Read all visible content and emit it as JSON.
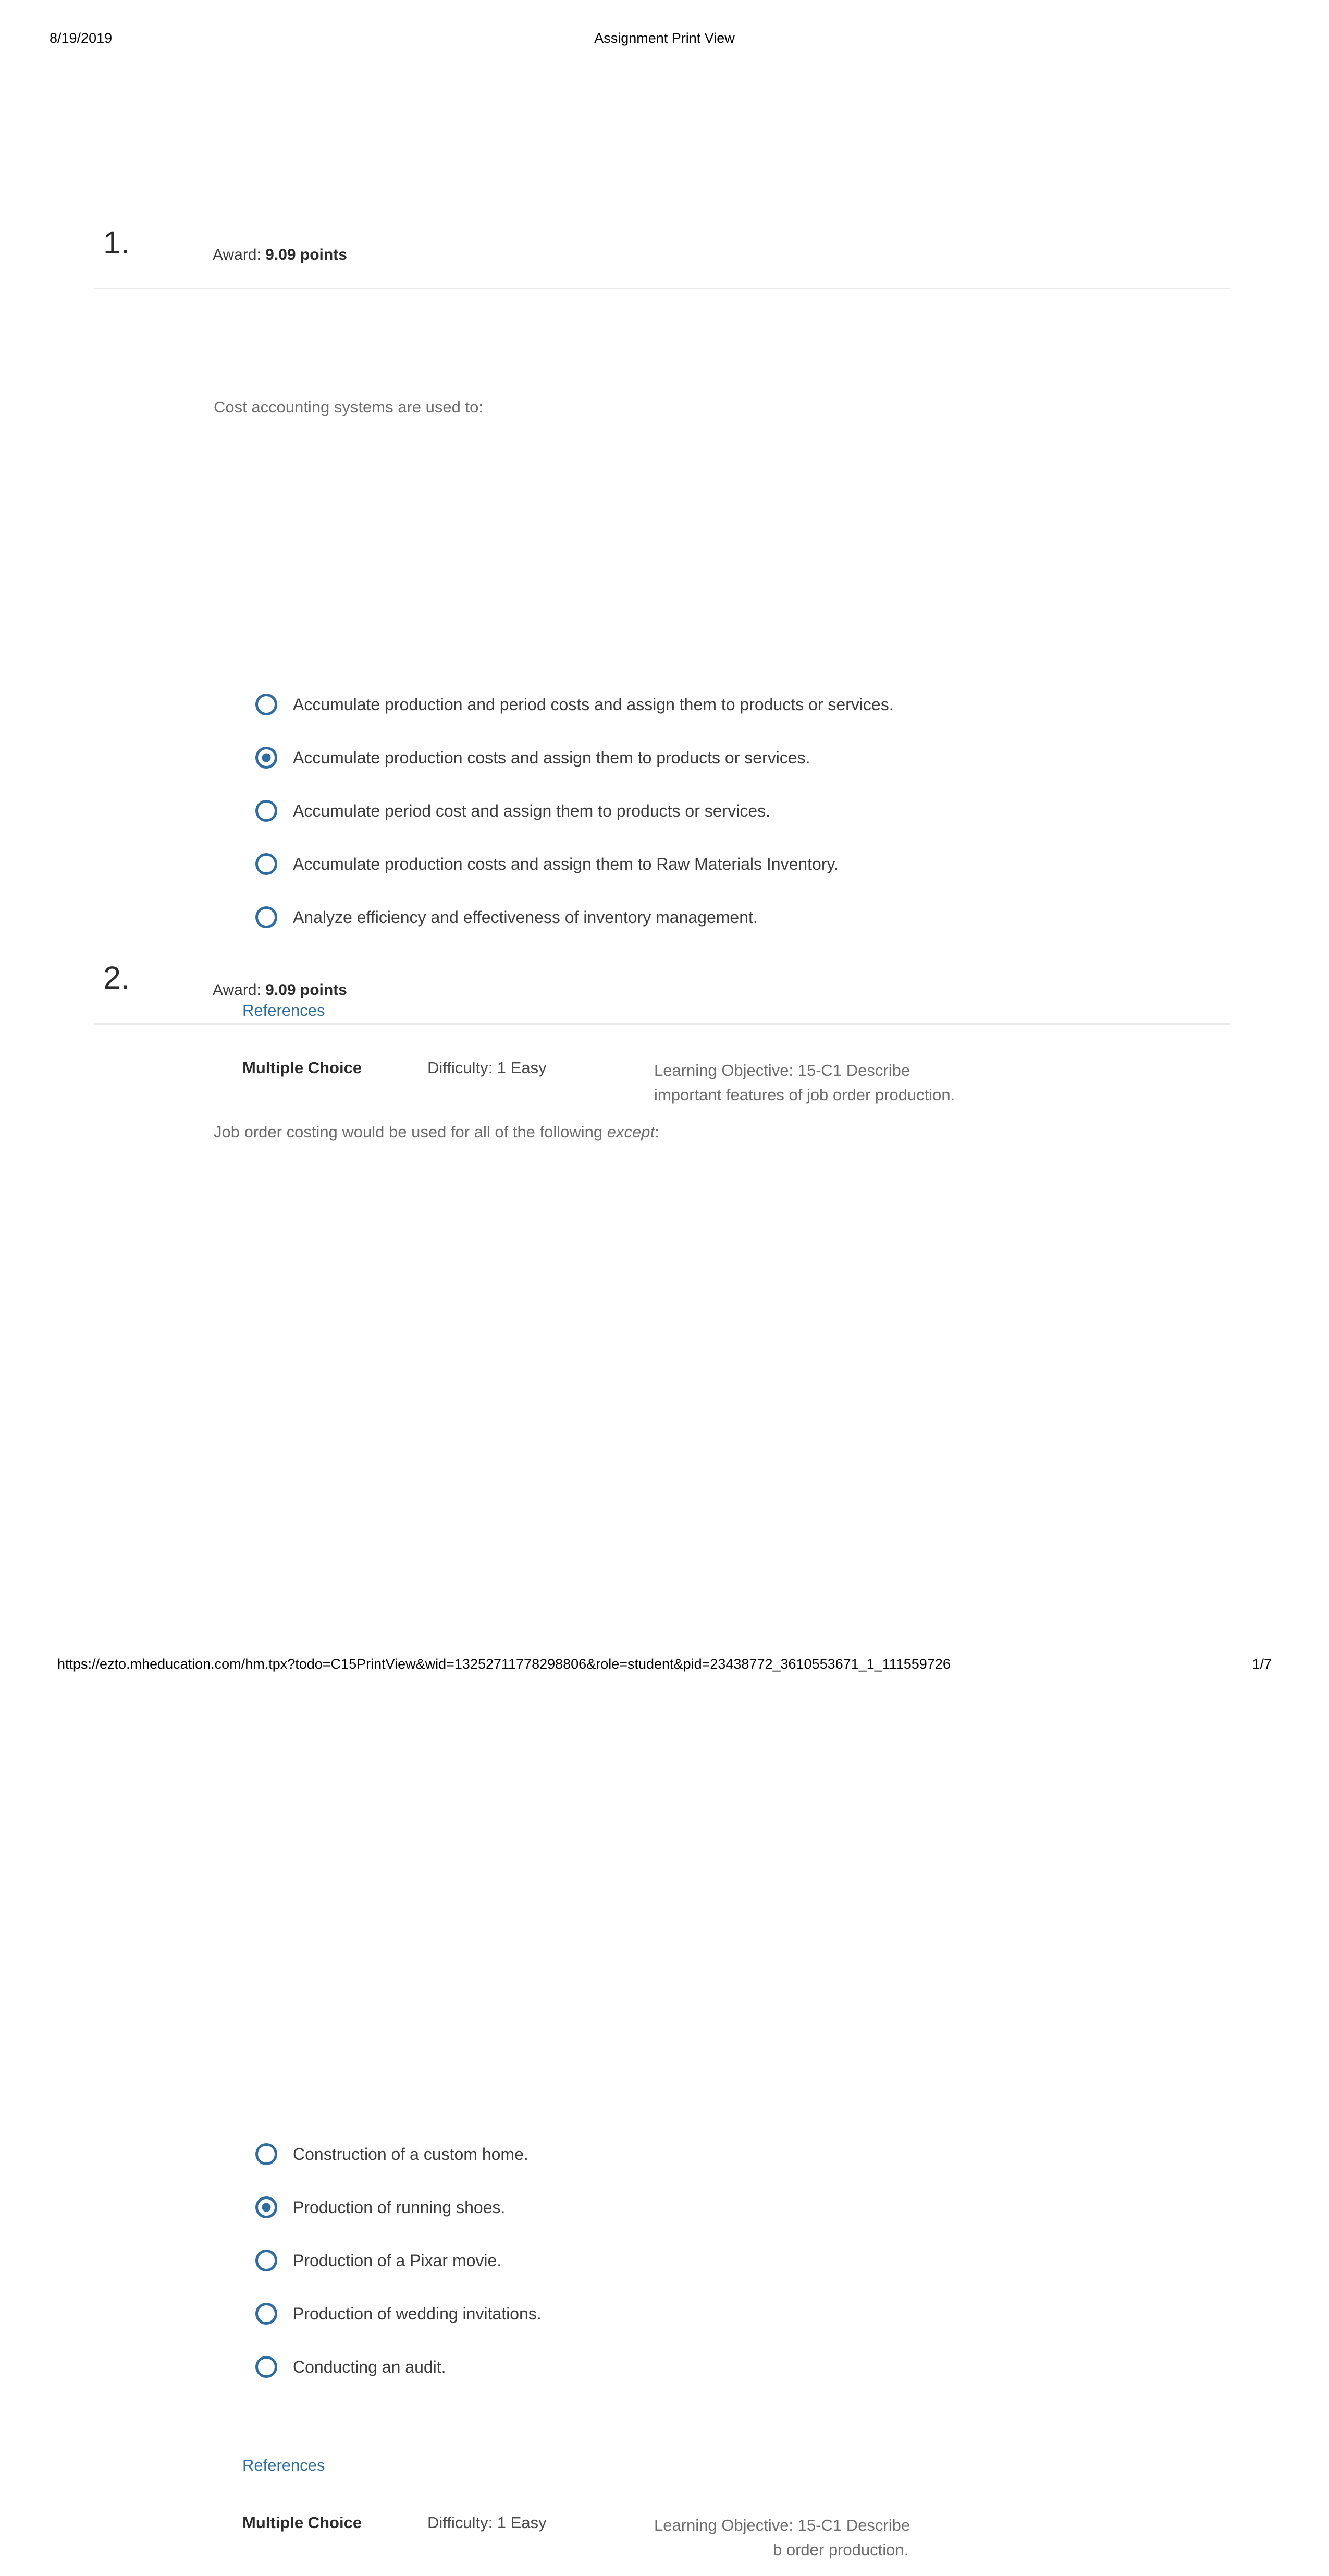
{
  "print_header": {
    "date": "8/19/2019",
    "title": "Assignment Print View"
  },
  "colors": {
    "link": "#2e6da4",
    "radio": "#2e6da4",
    "stem_text": "#6d6d6d",
    "body_text": "#3c3c3c"
  },
  "questions": [
    {
      "number": "1.",
      "award_prefix": "Award: ",
      "award_points": "9.09 points",
      "stem_before": "Cost accounting systems are used to:",
      "stem_italic": "",
      "stem_after": "",
      "choices": [
        {
          "label": "Accumulate production and period costs and assign them to products or services.",
          "selected": false
        },
        {
          "label": "Accumulate production costs and assign them to products or services.",
          "selected": true
        },
        {
          "label": "Accumulate period cost and assign them to products or services.",
          "selected": false
        },
        {
          "label": "Accumulate production costs and assign them to Raw Materials Inventory.",
          "selected": false
        },
        {
          "label": "Analyze efficiency and effectiveness of inventory management.",
          "selected": false
        }
      ],
      "references_label": "References",
      "meta": {
        "type": "Multiple Choice",
        "difficulty": "Difficulty: 1 Easy",
        "learning_objective_line1": "Learning Objective: 15-C1 Describe",
        "learning_objective_line2": "important features of job order production.",
        "learning_objective_line2_indented": false
      }
    },
    {
      "number": "2.",
      "award_prefix": "Award: ",
      "award_points": "9.09 points",
      "stem_before": "Job order costing would be used for all of the following ",
      "stem_italic": "except",
      "stem_after": ":",
      "choices": [
        {
          "label": "Construction of a custom home.",
          "selected": false
        },
        {
          "label": "Production of running shoes.",
          "selected": true
        },
        {
          "label": "Production of a Pixar movie.",
          "selected": false
        },
        {
          "label": "Production of wedding invitations.",
          "selected": false
        },
        {
          "label": "Conducting an audit.",
          "selected": false
        }
      ],
      "references_label": "References",
      "meta": {
        "type": "Multiple Choice",
        "difficulty": "Difficulty: 1 Easy",
        "learning_objective_line1": "Learning Objective: 15-C1 Describe",
        "learning_objective_line2": "b order production.",
        "learning_objective_line2_indented": true
      }
    }
  ],
  "print_footer": {
    "url": "https://ezto.mheducation.com/hm.tpx?todo=C15PrintView&wid=13252711778298806&role=student&pid=23438772_3610553671_1_111559726",
    "page": "1/7"
  }
}
